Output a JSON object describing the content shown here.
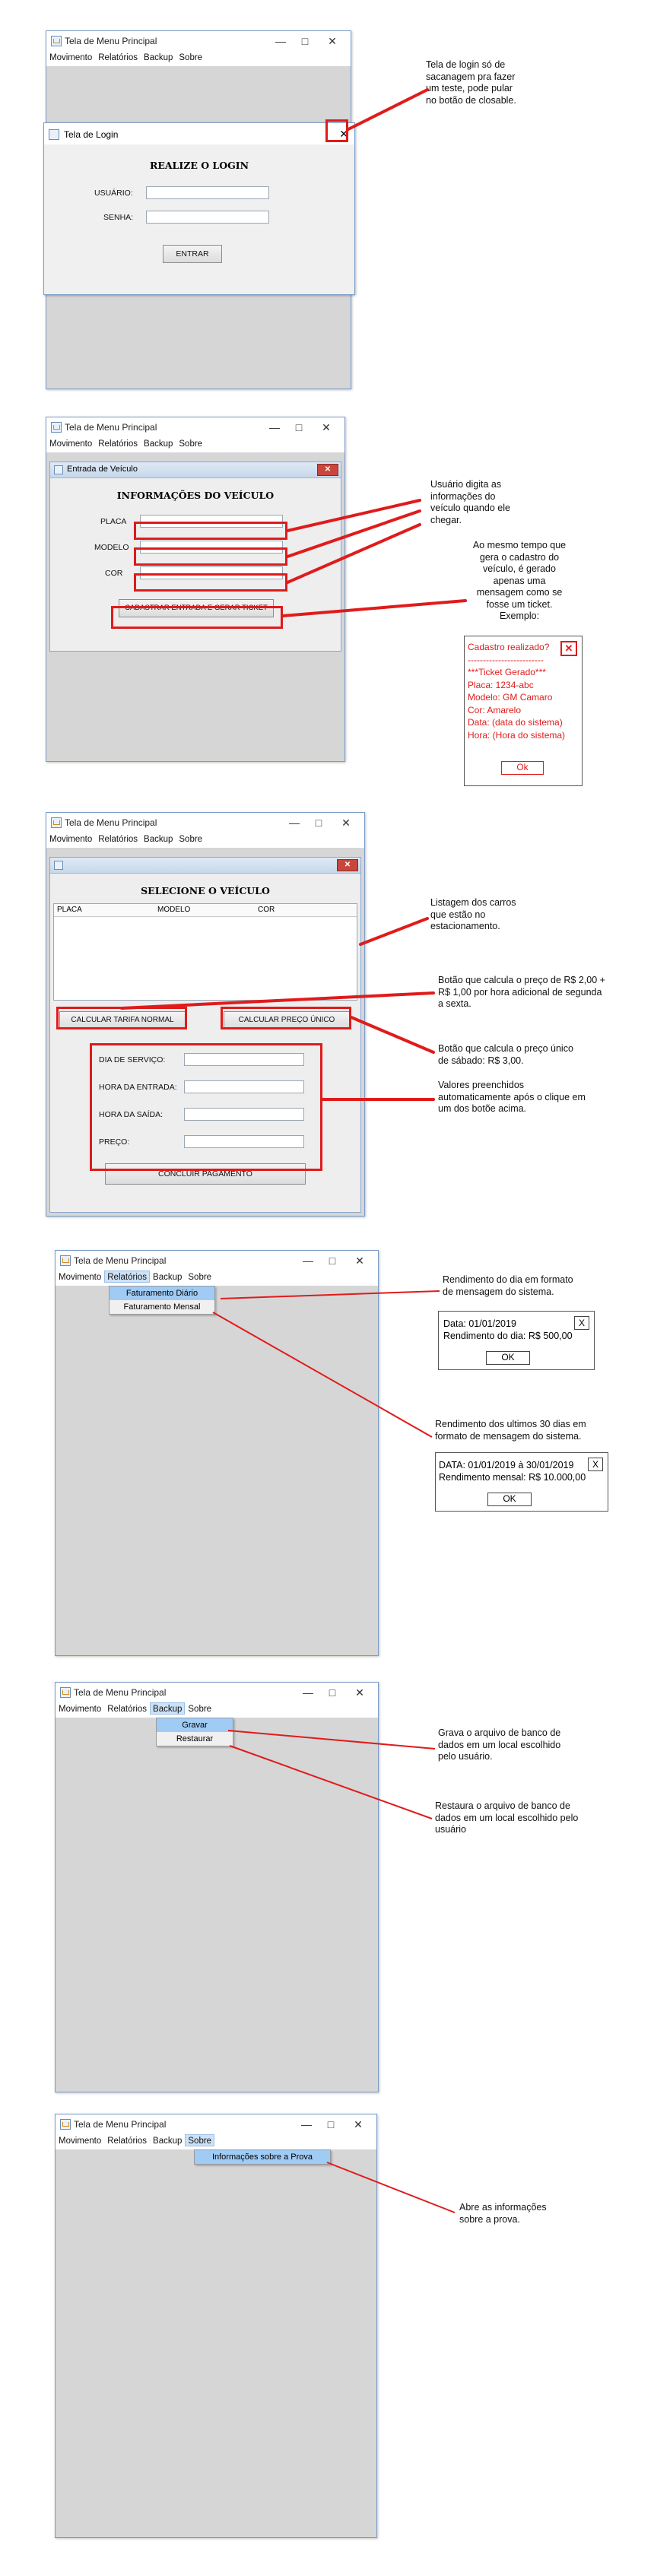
{
  "menu": {
    "title": "Tela de Menu Principal",
    "items": [
      "Movimento",
      "Relatórios",
      "Backup",
      "Sobre"
    ]
  },
  "login": {
    "dialog_title": "Tela de Login",
    "heading": "REALIZE O LOGIN",
    "user_label": "USUÁRIO:",
    "password_label": "SENHA:",
    "enter_button": "ENTRAR",
    "note": [
      "Tela de login só de",
      "sacanagem pra fazer",
      "um teste, pode pular",
      "no botão de closable."
    ]
  },
  "entry": {
    "dialog_title": "Entrada de Veículo",
    "heading": "INFORMAÇÕES DO VEÍCULO",
    "plate_label": "PLACA",
    "model_label": "MODELO",
    "color_label": "COR",
    "register_button": "CADASTRAR ENTRADA E GERAR TICKET",
    "note1": [
      "Usuário digita as",
      "informações do",
      "veículo quando ele",
      "chegar."
    ],
    "note2": [
      "Ao mesmo tempo que",
      "gera o cadastro do",
      "veículo, é gerado",
      "apenas uma",
      "mensagem como se",
      "fosse um ticket.",
      "Exemplo:"
    ],
    "ticket": {
      "lines": [
        "Cadastro realizado?",
        "-------------------------",
        "***Ticket Gerado***",
        "Placa: 1234-abc",
        "Modelo: GM Camaro",
        "Cor: Amarelo",
        "Data: (data do sistema)",
        "Hora: (Hora do sistema)"
      ],
      "ok": "Ok",
      "color": "#e01b1b"
    }
  },
  "exit": {
    "heading": "SELECIONE O VEÍCULO",
    "columns": [
      "PLACA",
      "MODELO",
      "COR"
    ],
    "normal_button": "CALCULAR TARIFA NORMAL",
    "single_button": "CALCULAR PREÇO ÚNICO",
    "service_day_label": "DIA DE SERVIÇO:",
    "entry_time_label": "HORA DA ENTRADA:",
    "exit_time_label": "HORA DA SAÍDA:",
    "price_label": "PREÇO:",
    "finish_button": "CONCLUIR PAGAMENTO",
    "note_list": [
      "Listagem dos carros",
      "que estão no",
      "estacionamento."
    ],
    "note_normal": [
      "Botão que calcula o preço de R$ 2,00 +",
      "R$ 1,00 por hora adicional de segunda",
      "a sexta."
    ],
    "note_single": [
      "Botão que calcula o preço único",
      "de sábado: R$ 3,00."
    ],
    "note_values": [
      "Valores preenchidos",
      "automaticamente após o clique em",
      "um dos botõe acima."
    ]
  },
  "reports": {
    "items": [
      "Faturamento Diário",
      "Faturamento Mensal"
    ],
    "note_daily": [
      "Rendimento do dia em formato",
      "de mensagem do sistema."
    ],
    "daily_msg": [
      "Data: 01/01/2019",
      "Rendimento do dia: R$ 500,00"
    ],
    "note_monthly": [
      "Rendimento dos ultimos 30 dias em",
      "formato de mensagem do sistema."
    ],
    "monthly_msg": [
      "DATA: 01/01/2019 à 30/01/2019",
      "Rendimento mensal: R$ 10.000,00"
    ],
    "ok": "OK",
    "close": "X"
  },
  "backup": {
    "items": [
      "Gravar",
      "Restaurar"
    ],
    "note_save": [
      "Grava o arquivo de banco de",
      "dados em um local escolhido",
      "pelo usuário."
    ],
    "note_restore": [
      "Restaura o arquivo de banco de",
      "dados em um local escolhido pelo",
      "usuário"
    ]
  },
  "about": {
    "items": [
      "Informações sobre a Prova"
    ],
    "note": [
      "Abre as informações",
      "sobre a prova."
    ]
  },
  "colors": {
    "annotation": "#e01b1b",
    "menu_bg": "#d6d6d6",
    "highlight": "#9fcbf4"
  }
}
